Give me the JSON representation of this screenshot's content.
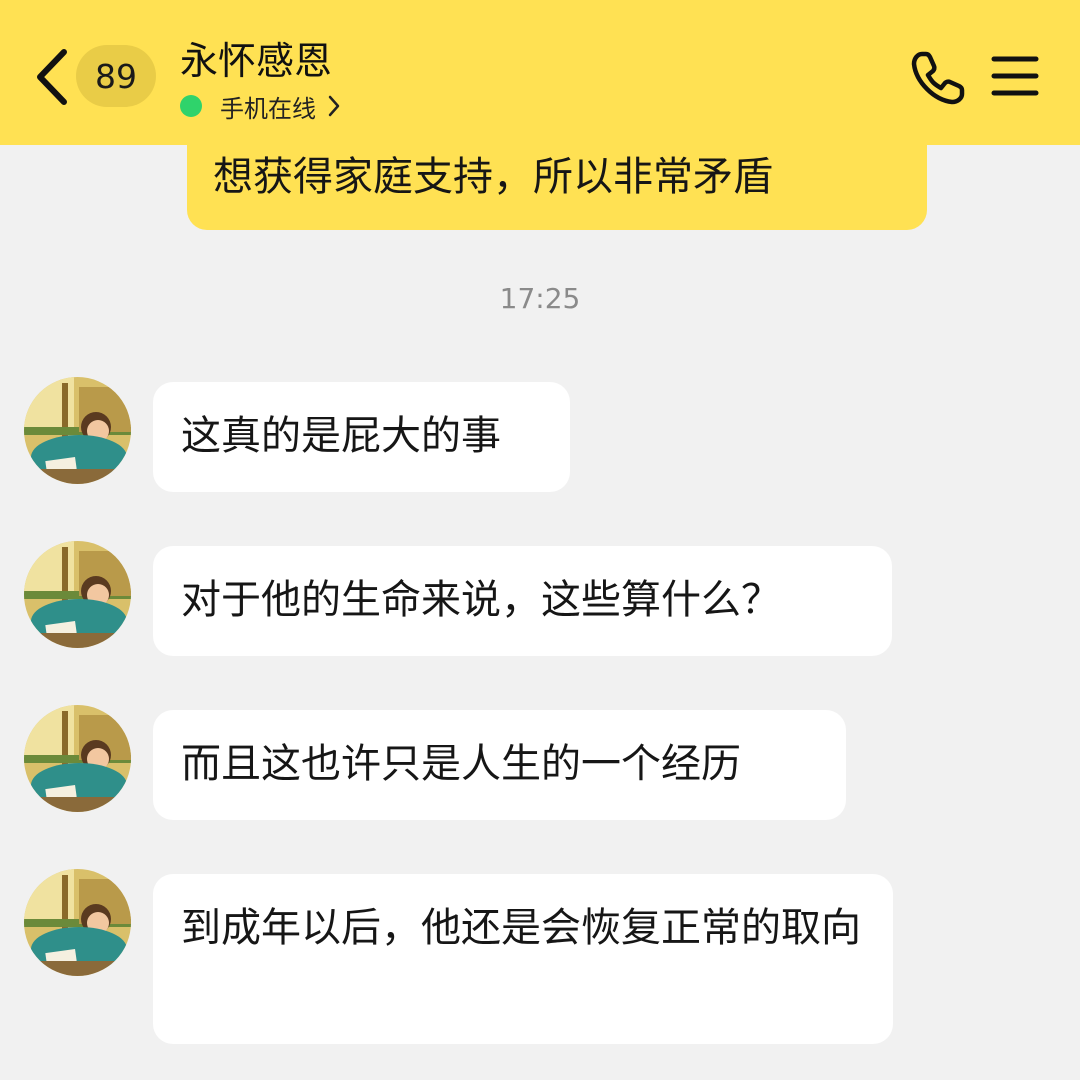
{
  "header": {
    "unread_count": "89",
    "contact_name": "永怀感恩",
    "status": "手机在线",
    "status_color": "#2fd36b",
    "background": "#ffe153",
    "icons": [
      "back-chevron-icon",
      "phone-icon",
      "menu-icon",
      "chevron-right-icon"
    ]
  },
  "messages": {
    "outgoing_partial": "想获得家庭支持，所以非常矛盾",
    "timestamp": "17:25",
    "incoming": [
      {
        "text": "这真的是屁大的事"
      },
      {
        "text": "对于他的生命来说，这些算什么？"
      },
      {
        "text": "而且这也许只是人生的一个经历"
      },
      {
        "text": "到成年以后，他还是会恢复正常的取向"
      }
    ]
  }
}
